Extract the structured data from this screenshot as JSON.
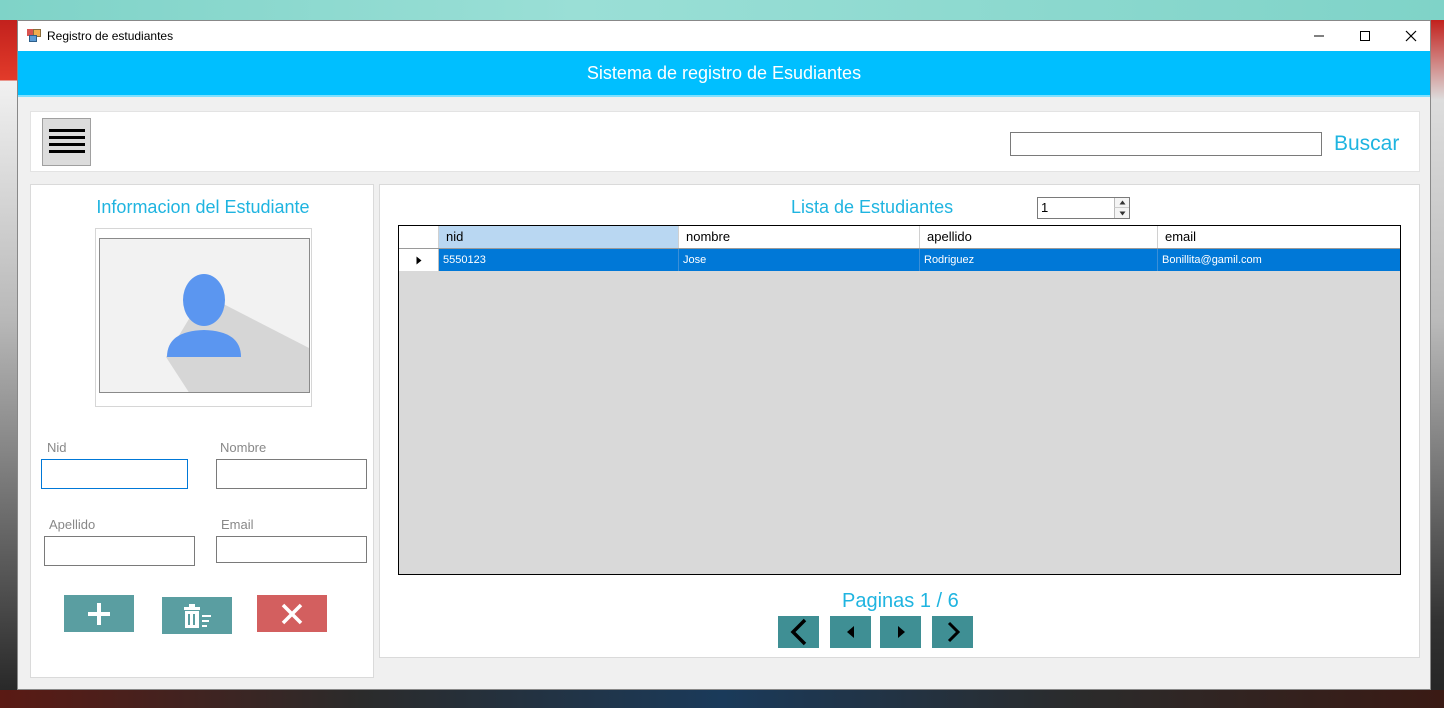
{
  "window": {
    "title": "Registro de estudiantes"
  },
  "header": {
    "title": "Sistema de registro de Esudiantes"
  },
  "toolbar": {
    "search_value": "",
    "search_label": "Buscar"
  },
  "left_panel": {
    "title": "Informacion del Estudiante",
    "fields": {
      "nid": {
        "label": "Nid",
        "value": ""
      },
      "nombre": {
        "label": "Nombre",
        "value": ""
      },
      "apellido": {
        "label": "Apellido",
        "value": ""
      },
      "email": {
        "label": "Email",
        "value": ""
      }
    }
  },
  "list_panel": {
    "title": "Lista de Estudiantes",
    "page_size_value": "1",
    "columns": [
      "nid",
      "nombre",
      "apellido",
      "email"
    ],
    "rows": [
      {
        "nid": "5550123",
        "nombre": "Jose",
        "apellido": "Rodriguez",
        "email": "Bonillita@gamil.com"
      }
    ],
    "pages_label": "Paginas 1 / 6"
  },
  "colors": {
    "header_bg": "#00bfff",
    "accent_text": "#1fb4e0",
    "add_button": "#5a9ea1",
    "delete_button": "#5a9ea1",
    "cancel_button": "#d35f5f",
    "nav_button": "#3f8f94",
    "selected_row": "#0078d7"
  },
  "icons": {
    "menu": "hamburger-icon",
    "add": "plus-icon",
    "delete": "trash-icon",
    "cancel": "close-icon",
    "first": "chevron-left-icon",
    "prev": "triangle-left-icon",
    "next": "triangle-right-icon",
    "last": "chevron-right-icon"
  }
}
